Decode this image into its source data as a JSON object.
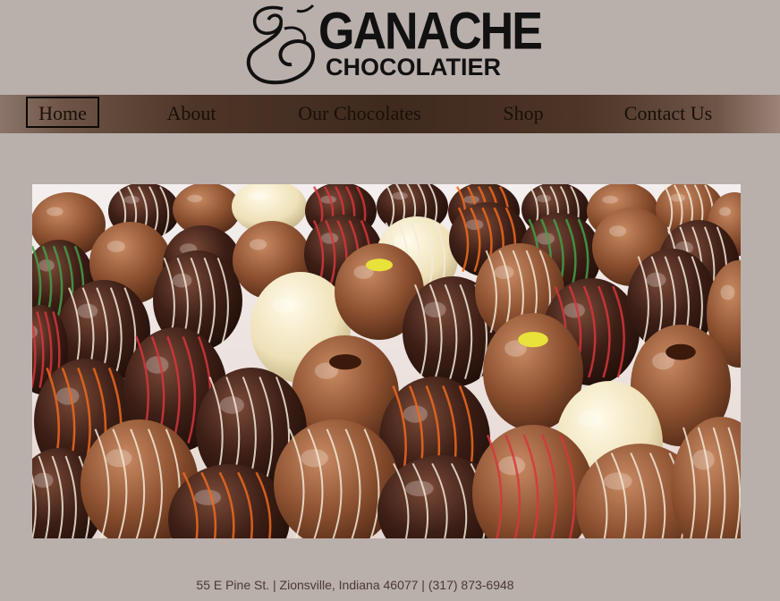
{
  "logo": {
    "word1": "GANACHE",
    "word2": "CHOCOLATIER",
    "icon": "script-letter-g-monogram"
  },
  "nav": {
    "items": [
      {
        "label": "Home",
        "active": true
      },
      {
        "label": "About",
        "active": false
      },
      {
        "label": "Our Chocolates",
        "active": false
      },
      {
        "label": "Shop",
        "active": false
      },
      {
        "label": "Contact Us",
        "active": false
      }
    ]
  },
  "hero": {
    "subject": "chocolate-truffle-eggs-photo"
  },
  "footer": {
    "address": "55 E Pine St. | Zionsville, Indiana 46077 | (317) 873-6948"
  },
  "colors": {
    "background": "#b9afab",
    "nav_dark": "#3f2a1e",
    "text_dark": "#1a0f08"
  }
}
